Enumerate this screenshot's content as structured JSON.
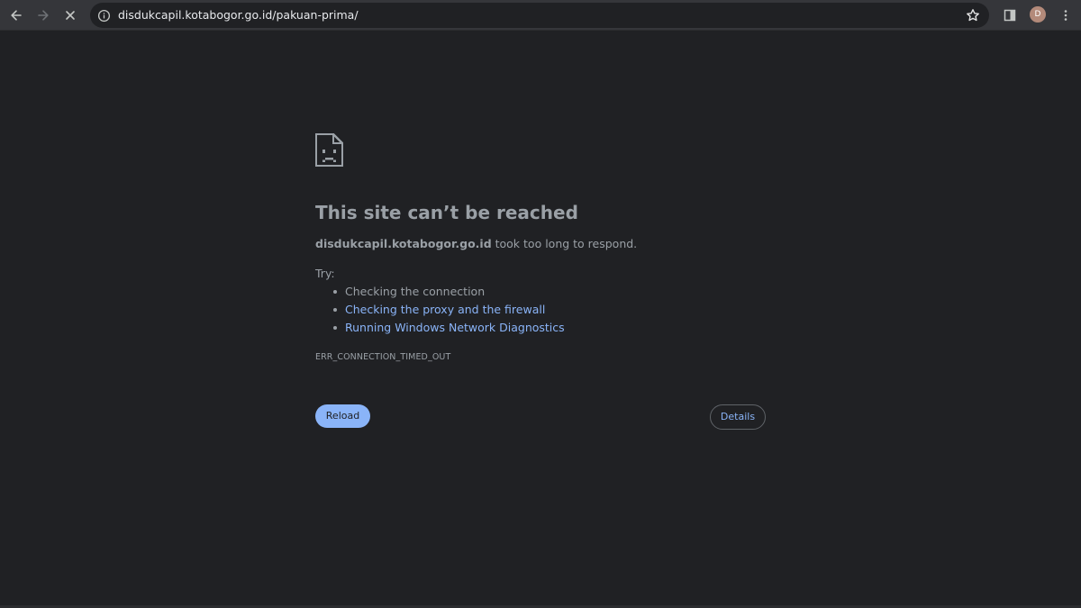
{
  "browser": {
    "url": "disdukcapil.kotabogor.go.id/pakuan-prima/",
    "avatar_initial": "D",
    "icons": {
      "back": "arrow-back-icon",
      "forward": "arrow-forward-icon",
      "stop": "close-icon",
      "site_info": "info-icon",
      "bookmark": "star-icon",
      "side_panel": "side-panel-icon",
      "menu": "more-vert-icon"
    }
  },
  "error_page": {
    "icon": "sad-page-icon",
    "title": "This site can’t be reached",
    "host": "disdukcapil.kotabogor.go.id",
    "message": " took too long to respond.",
    "try_label": "Try:",
    "suggestions": [
      {
        "text": "Checking the connection",
        "is_link": false
      },
      {
        "text": "Checking the proxy and the firewall",
        "is_link": true
      },
      {
        "text": "Running Windows Network Diagnostics",
        "is_link": true
      }
    ],
    "error_code": "ERR_CONNECTION_TIMED_OUT",
    "reload_label": "Reload",
    "details_label": "Details"
  },
  "colors": {
    "background": "#202124",
    "toolbar": "#35363a",
    "text": "#9aa0a6",
    "link": "#8ab4f8",
    "primary_button": "#8ab4f8"
  }
}
